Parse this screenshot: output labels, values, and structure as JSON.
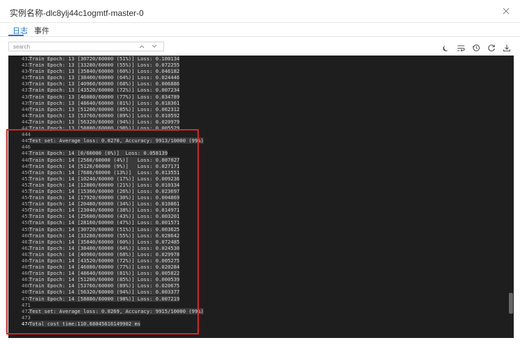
{
  "window": {
    "title": "实例名称-dlc8ylj44c1ogmtf-master-0"
  },
  "tabs": [
    {
      "label": "日志",
      "active": true
    },
    {
      "label": "事件",
      "active": false
    }
  ],
  "search": {
    "placeholder": "search"
  },
  "toolbar": {
    "icons": [
      "theme-icon",
      "wrap-icon",
      "history-icon",
      "refresh-icon",
      "download-icon"
    ]
  },
  "colors": {
    "accent": "#1a73e8",
    "terminal_bg": "#1e1e1e",
    "highlight": "#e22020"
  },
  "log": [
    {
      "n": "432",
      "t": "Train Epoch: 13 [30720/60000 (51%)] Loss: 0.100134"
    },
    {
      "n": "433",
      "t": "Train Epoch: 13 [33280/60000 (55%)] Loss: 0.072255"
    },
    {
      "n": "434",
      "t": "Train Epoch: 13 [35840/60000 (60%)] Loss: 0.046182"
    },
    {
      "n": "435",
      "t": "Train Epoch: 13 [38400/60000 (64%)] Loss: 0.024446"
    },
    {
      "n": "436",
      "t": "Train Epoch: 13 [40960/60000 (68%)] Loss: 0.006886"
    },
    {
      "n": "437",
      "t": "Train Epoch: 13 [43520/60000 (72%)] Loss: 0.007234"
    },
    {
      "n": "438",
      "t": "Train Epoch: 13 [46080/60000 (77%)] Loss: 0.034789"
    },
    {
      "n": "439",
      "t": "Train Epoch: 13 [48640/60000 (81%)] Loss: 0.018361"
    },
    {
      "n": "440",
      "t": "Train Epoch: 13 [51200/60000 (85%)] Loss: 0.062312"
    },
    {
      "n": "441",
      "t": "Train Epoch: 13 [53760/60000 (89%)] Loss: 0.010592"
    },
    {
      "n": "442",
      "t": "Train Epoch: 13 [56320/60000 (94%)] Loss: 0.020979"
    },
    {
      "n": "443",
      "t": "Train Epoch: 13 [58880/60000 (98%)] Loss: 0.005529"
    },
    {
      "n": "444",
      "t": ""
    },
    {
      "n": "445",
      "t": "Test set: Average loss: 0.0270, Accuracy: 9913/10000 (99%)"
    },
    {
      "n": "446",
      "t": ""
    },
    {
      "n": "447",
      "t": "Train Epoch: 14 [0/60000 (0%)]  Loss: 0.058139"
    },
    {
      "n": "448",
      "t": "Train Epoch: 14 [2560/60000 (4%)]   Loss: 0.007027"
    },
    {
      "n": "449",
      "t": "Train Epoch: 14 [5120/60000 (9%)]   Loss: 0.027171"
    },
    {
      "n": "450",
      "t": "Train Epoch: 14 [7680/60000 (13%)]  Loss: 0.013551"
    },
    {
      "n": "451",
      "t": "Train Epoch: 14 [10240/60000 (17%)] Loss: 0.009236"
    },
    {
      "n": "452",
      "t": "Train Epoch: 14 [12800/60000 (21%)] Loss: 0.010334"
    },
    {
      "n": "453",
      "t": "Train Epoch: 14 [15360/60000 (26%)] Loss: 0.023697"
    },
    {
      "n": "454",
      "t": "Train Epoch: 14 [17920/60000 (30%)] Loss: 0.004869"
    },
    {
      "n": "455",
      "t": "Train Epoch: 14 [20480/60000 (34%)] Loss: 0.010861"
    },
    {
      "n": "456",
      "t": "Train Epoch: 14 [23040/60000 (38%)] Loss: 0.014971"
    },
    {
      "n": "457",
      "t": "Train Epoch: 14 [25600/60000 (43%)] Loss: 0.003201"
    },
    {
      "n": "458",
      "t": "Train Epoch: 14 [28160/60000 (47%)] Loss: 0.001571"
    },
    {
      "n": "459",
      "t": "Train Epoch: 14 [30720/60000 (51%)] Loss: 0.003625"
    },
    {
      "n": "460",
      "t": "Train Epoch: 14 [33280/60000 (55%)] Loss: 0.028642"
    },
    {
      "n": "461",
      "t": "Train Epoch: 14 [35840/60000 (60%)] Loss: 0.072485"
    },
    {
      "n": "462",
      "t": "Train Epoch: 14 [38400/60000 (64%)] Loss: 0.024530"
    },
    {
      "n": "463",
      "t": "Train Epoch: 14 [40960/60000 (68%)] Loss: 0.029978"
    },
    {
      "n": "464",
      "t": "Train Epoch: 14 [43520/60000 (72%)] Loss: 0.005275"
    },
    {
      "n": "465",
      "t": "Train Epoch: 14 [46080/60000 (77%)] Loss: 0.020284"
    },
    {
      "n": "466",
      "t": "Train Epoch: 14 [48640/60000 (81%)] Loss: 0.005822"
    },
    {
      "n": "467",
      "t": "Train Epoch: 14 [51200/60000 (85%)] Loss: 0.000539"
    },
    {
      "n": "468",
      "t": "Train Epoch: 14 [53760/60000 (89%)] Loss: 0.020675"
    },
    {
      "n": "469",
      "t": "Train Epoch: 14 [56320/60000 (94%)] Loss: 0.003377"
    },
    {
      "n": "470",
      "t": "Train Epoch: 14 [58880/60000 (98%)] Loss: 0.007219"
    },
    {
      "n": "471",
      "t": ""
    },
    {
      "n": "472",
      "t": "Test set: Average loss: 0.0269, Accuracy: 9915/10000 (99%)"
    },
    {
      "n": "473",
      "t": ""
    },
    {
      "n": "474",
      "t": "Total cost time:110.68045616149902 ms"
    }
  ]
}
